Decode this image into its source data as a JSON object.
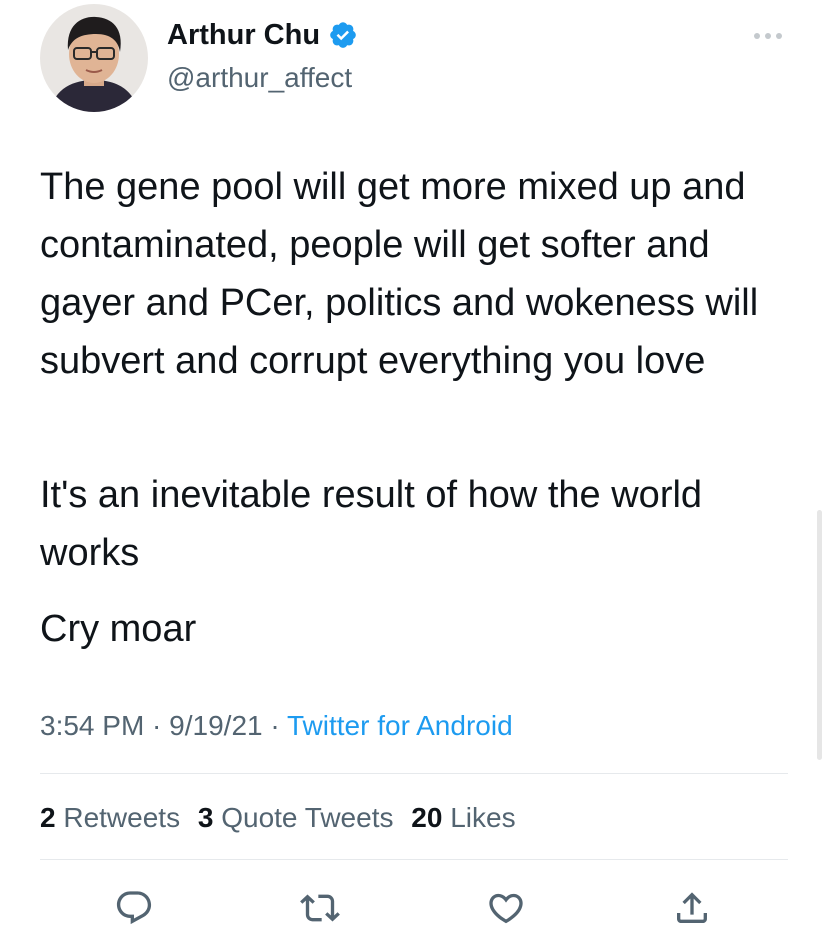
{
  "author": {
    "display_name": "Arthur Chu",
    "handle": "@arthur_affect",
    "verified": true,
    "avatar_icon": "profile-photo"
  },
  "tweet": {
    "paragraphs": [
      "The gene pool will get more mixed up and contaminated, people will get softer and gayer and PCer, politics and wokeness will subvert and corrupt everything you love",
      "It's an inevitable result of how the world works",
      "Cry moar"
    ],
    "time": "3:54 PM",
    "date": "9/19/21",
    "source": "Twitter for Android",
    "separator": " · "
  },
  "stats": {
    "retweets_count": "2",
    "retweets_label": "Retweets",
    "quotes_count": "3",
    "quotes_label": "Quote Tweets",
    "likes_count": "20",
    "likes_label": "Likes"
  },
  "actions": [
    {
      "icon": "reply-icon"
    },
    {
      "icon": "retweet-icon"
    },
    {
      "icon": "like-icon"
    },
    {
      "icon": "share-icon"
    }
  ],
  "colors": {
    "text": "#0f1419",
    "secondary": "#536471",
    "link": "#1d9bf0",
    "verified": "#1d9bf0",
    "divider": "#e6e9ec"
  }
}
